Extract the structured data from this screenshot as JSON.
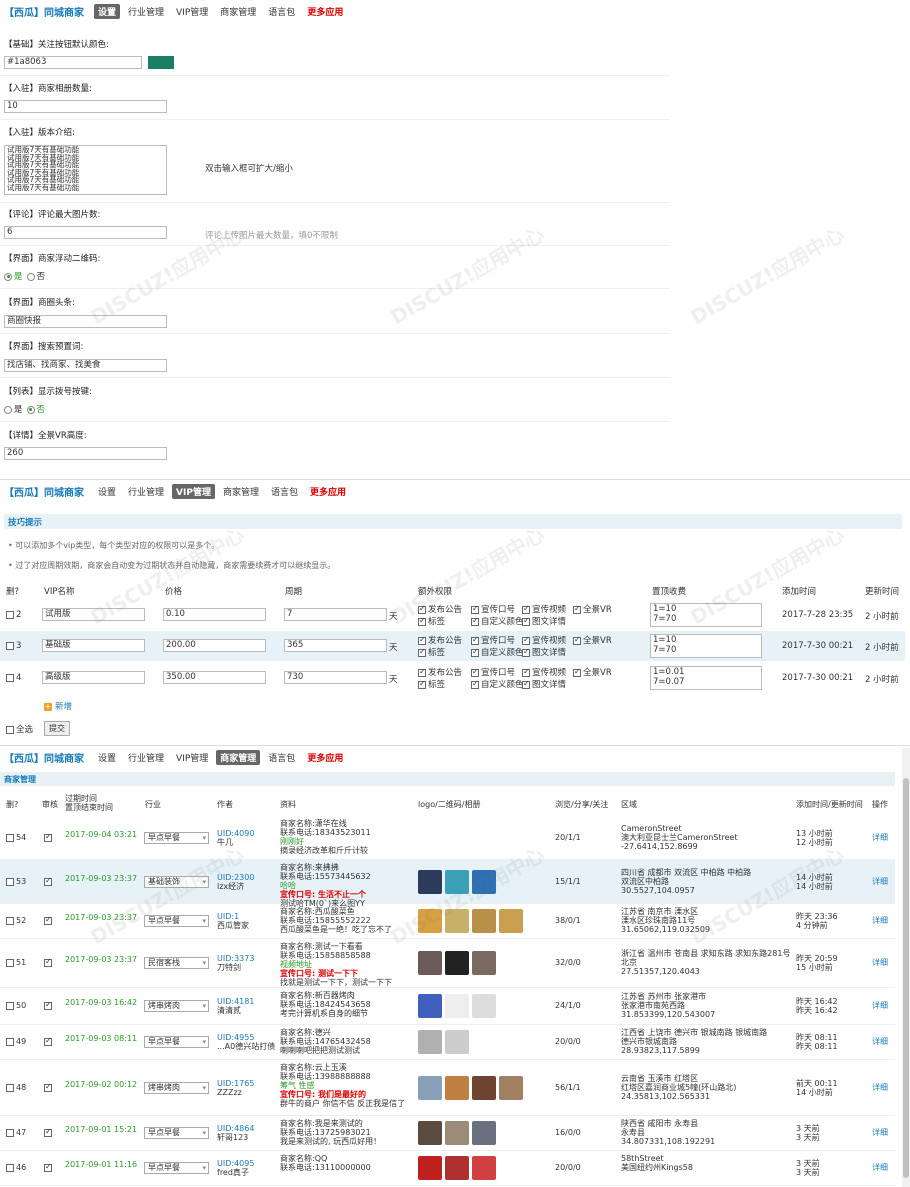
{
  "nav": {
    "brand": "【西瓜】同城商家",
    "tabs": [
      "设置",
      "行业管理",
      "VIP管理",
      "商家管理",
      "语言包",
      "更多应用"
    ]
  },
  "settings": {
    "follow_color_label": "【基础】关注按钮默认颜色:",
    "follow_color_value": "#1a8063",
    "follow_color_swatch": "#1a8063",
    "album_label": "【入驻】商家相册数量:",
    "album_value": "10",
    "version_label": "【入驻】版本介绍:",
    "version_lines": [
      "试用版7天有基础功能",
      "试用版7天有基础功能",
      "试用版7天有基础功能",
      "试用版7天有基础功能",
      "试用版7天有基础功能",
      "试用版7天有基础功能"
    ],
    "version_hint": "双击输入框可扩大/缩小",
    "comment_label": "【评论】评论最大图片数:",
    "comment_value": "6",
    "comment_hint": "评论上传图片最大数量，填0不限制",
    "qrcode_label": "【界面】商家浮动二维码:",
    "yes": "是",
    "no": "否",
    "headline_label": "【界面】商圈头条:",
    "headline_value": "商圈快报",
    "search_label": "【界面】搜索预置词:",
    "search_value": "找店铺、找商家、找美食",
    "dial_label": "【列表】显示拨号按键:",
    "vr_label": "【详情】全景VR高度:",
    "vr_value": "260"
  },
  "vip": {
    "tips_title": "技巧提示",
    "tips": [
      "可以添加多个vip类型，每个类型对应的权限可以是多个。",
      "过了对应周期效期，商家会自动变为过期状态并自动隐藏，商家需要续费才可以继续显示。"
    ],
    "headers": [
      "删?",
      "VIP名称",
      "价格",
      "周期",
      "额外权限",
      "置顶收费",
      "添加时间",
      "更新时间"
    ],
    "day_unit": "天",
    "perm_labels": [
      "发布公告",
      "宣传口号",
      "宣传视频",
      "全景VR",
      "标签",
      "自定义颜色",
      "图文详情"
    ],
    "rows": [
      {
        "id": "2",
        "name": "试用版",
        "price": "0.10",
        "period": "7",
        "top": [
          "1=10",
          "7=70"
        ],
        "added": "2017-7-28 23:35",
        "updated": "2 小时前"
      },
      {
        "id": "3",
        "name": "基础版",
        "price": "200.00",
        "period": "365",
        "top": [
          "1=10",
          "7=70"
        ],
        "added": "2017-7-30 00:21",
        "updated": "2 小时前"
      },
      {
        "id": "4",
        "name": "高级版",
        "price": "350.00",
        "period": "730",
        "top": [
          "1=0.01",
          "7=0.07"
        ],
        "added": "2017-7-30 00:21",
        "updated": "2 小时前"
      }
    ],
    "add_label": "新增",
    "select_all": "全选",
    "submit": "提交"
  },
  "merchants": {
    "section_title": "商家管理",
    "headers": [
      "删?",
      "审核",
      "过期时间\n置顶结束时间",
      "行业",
      "作者",
      "资料",
      "logo/二维码/相册",
      "浏览/分享/关注",
      "区域",
      "添加时间/更新时间",
      "操作"
    ],
    "detail": "详细",
    "rows": [
      {
        "id": "54",
        "expire": "2017-09-04 03:21",
        "industry": "早点早餐",
        "uid": "UID:4090",
        "author": "牛几",
        "info": [
          "商家名称:潇华在线",
          "联系电话:18343523011"
        ],
        "tag": "刚刚好",
        "slogan": "",
        "extra": "摘录经济改革和斤斤计较",
        "stats": "20/1/1",
        "area": [
          "CameronStreet",
          "澳大利亚昆士兰CameronStreet",
          "-27.6414,152.8699"
        ],
        "time": [
          "13 小时前",
          "12 小时前"
        ],
        "thumbs": []
      },
      {
        "id": "53",
        "expire": "2017-09-03 23:37",
        "industry": "基础装饰",
        "uid": "UID:2300",
        "author": "lzx经济",
        "info": [
          "商家名称:来拂拂",
          "联系电话:15573445632"
        ],
        "tag": "哈哈",
        "slogan": "宣传口号: 生活不止一个",
        "extra": "测试哈TM(0`)来么图YY",
        "stats": "15/1/1",
        "area": [
          "四川省 成都市 双流区 中柏路 中柏路",
          "双流区中柏路",
          "30.5527,104.0957"
        ],
        "time": [
          "14 小时前",
          "14 小时前"
        ],
        "thumbs": [
          "#2a3b5c",
          "#3aa0b8",
          "#2d6fb5"
        ]
      },
      {
        "id": "52",
        "expire": "2017-09-03 23:37",
        "industry": "早点早餐",
        "uid": "UID:1",
        "author": "西瓜管家",
        "info": [
          "商家名称:西瓜酸菜鱼",
          "联系电话:15855552222"
        ],
        "tag": "",
        "slogan": "",
        "extra": "西瓜酸菜鱼是一绝！吃了忘不了",
        "stats": "38/0/1",
        "area": [
          "江苏省 南京市 溧水区",
          "溧水区珍珠南路11号",
          "31.65062,119.032509"
        ],
        "time": [
          "昨天 23:36",
          "4 分钟前"
        ],
        "thumbs": [
          "#d8a040",
          "#c9b068",
          "#b89048",
          "#caa050"
        ]
      },
      {
        "id": "51",
        "expire": "2017-09-03 23:37",
        "industry": "民宿客栈",
        "uid": "UID:3373",
        "author": "刀特剑",
        "info": [
          "商家名称:测试一下看看",
          "联系电话:15858858588"
        ],
        "tag": "视频地址",
        "slogan": "宣传口号: 测试一下下",
        "extra": "找就是测试一下下，测试一下下",
        "stats": "32/0/0",
        "area": [
          "浙江省 温州市 苍南县 求知东路 求知东路281号",
          "北京",
          "27.51357,120.4043"
        ],
        "time": [
          "昨天 20:59",
          "15 小时前"
        ],
        "thumbs": [
          "#6a5a58",
          "#222",
          "#7a6a60"
        ]
      },
      {
        "id": "50",
        "expire": "2017-09-03 16:42",
        "industry": "烤串烤肉",
        "uid": "UID:4181",
        "author": "清清贰",
        "info": [
          "商家名称:新百器烤肉",
          "联系电话:18424543658"
        ],
        "tag": "",
        "slogan": "",
        "extra": "考完计算机系自身的细节",
        "stats": "24/1/0",
        "area": [
          "江苏省 苏州市 张家港市",
          "张家港市南苑西路",
          "31.853399,120.543007"
        ],
        "time": [
          "昨天 16:42",
          "昨天 16:42"
        ],
        "thumbs": [
          "#4060c0",
          "#eee",
          "#ddd"
        ]
      },
      {
        "id": "49",
        "expire": "2017-09-03 08:11",
        "industry": "早点早餐",
        "uid": "UID:4955",
        "author": "...A0德兴站打债",
        "info": [
          "商家名称:德兴",
          "联系电话:14765432458"
        ],
        "tag": "",
        "slogan": "",
        "extra": "喇喇喇吧把把测试测试",
        "stats": "20/0/0",
        "area": [
          "江西省 上饶市 德兴市 银城南路 银城南路",
          "德兴市银城南路",
          "28.93823,117.5899"
        ],
        "time": [
          "昨天 08:11",
          "昨天 08:11"
        ],
        "thumbs": [
          "#b0b0b0",
          "#ccc"
        ]
      },
      {
        "id": "48",
        "expire": "2017-09-02 00:12",
        "industry": "烤串烤肉",
        "uid": "UID:1765",
        "author": "ZZZzz",
        "info": [
          "商家名称:云上玉溪",
          "联系电话:13988888888"
        ],
        "tag": "筹气 性感",
        "slogan": "宣传口号: 我们是最好的",
        "extra": "群牛的商户 你信不信 反正我是信了",
        "stats": "56/1/1",
        "area": [
          "云南省 玉溪市 红塔区",
          "红塔区嘉润商业城5幢(环山路北)",
          "24.35813,102.565331"
        ],
        "time": [
          "前天 00:11",
          "14 小时前"
        ],
        "thumbs": [
          "#8aa0b8",
          "#c08040",
          "#704030",
          "#a08060"
        ]
      },
      {
        "id": "47",
        "expire": "2017-09-01 15:21",
        "industry": "早点早餐",
        "uid": "UID:4864",
        "author": "轩哥123",
        "info": [
          "商家名称:我是来测试的",
          "联系电话:13725983021"
        ],
        "tag": "",
        "slogan": "",
        "extra": "我是来测试的, 玩西瓜好用！",
        "stats": "16/0/0",
        "area": [
          "陕西省 咸阳市 永寿县",
          "永寿县",
          "34.807331,108.192291"
        ],
        "time": [
          "3 天前",
          "3 天前"
        ],
        "thumbs": [
          "#5a4a40",
          "#9a8a78",
          "#6a7080"
        ]
      },
      {
        "id": "46",
        "expire": "2017-09-01 11:16",
        "industry": "早点早餐",
        "uid": "UID:4095",
        "author": "fred真子",
        "info": [
          "商家名称:QQ",
          "联系电话:13110000000"
        ],
        "tag": "",
        "slogan": "",
        "extra": "",
        "stats": "20/0/0",
        "area": [
          "58thStreet",
          "美国纽约州Kings58",
          ""
        ],
        "time": [
          "3 天前",
          "3 天前"
        ],
        "thumbs": [
          "#c02020",
          "#b03030",
          "#d04040"
        ]
      }
    ]
  },
  "watermark": [
    "DISCUZ!应用中心",
    "addon.dismall.com",
    "贰道"
  ]
}
